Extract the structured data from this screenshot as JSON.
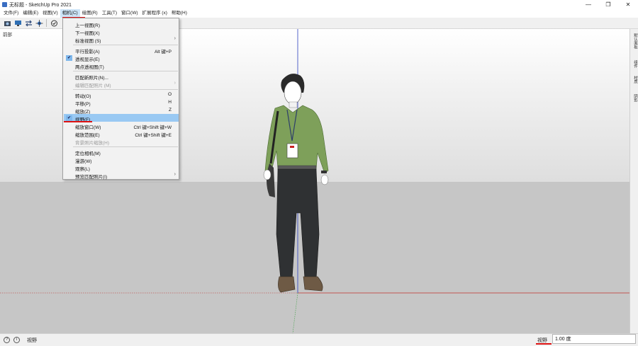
{
  "window": {
    "title": "无标题 - SketchUp Pro 2021",
    "controls": {
      "minimize": "—",
      "maximize": "❐",
      "close": "✕"
    }
  },
  "menubar": [
    {
      "label": "文件(F)"
    },
    {
      "label": "编辑(E)"
    },
    {
      "label": "视图(V)"
    },
    {
      "label": "相机(C)",
      "active": true
    },
    {
      "label": "绘图(R)"
    },
    {
      "label": "工具(T)"
    },
    {
      "label": "窗口(W)"
    },
    {
      "label": "扩展程序 (x)"
    },
    {
      "label": "帮助(H)"
    }
  ],
  "scene": {
    "label": "前部"
  },
  "camera_menu": {
    "items": [
      {
        "label": "上一视图(R)"
      },
      {
        "label": "下一视图(X)"
      },
      {
        "label": "标准视图 (S)",
        "submenu": true
      },
      {
        "separator": true
      },
      {
        "label": "平行投影(A)",
        "shortcut": "Alt 键+P"
      },
      {
        "label": "透视显示(E)",
        "checked": true
      },
      {
        "label": "两点透视图(T)"
      },
      {
        "separator": true
      },
      {
        "label": "匹配新照片(N)..."
      },
      {
        "label": "编辑匹配照片 (M)",
        "submenu": true,
        "disabled": true
      },
      {
        "separator": true
      },
      {
        "label": "转动(O)",
        "shortcut": "O"
      },
      {
        "label": "平移(P)",
        "shortcut": "H"
      },
      {
        "label": "缩放(Z)",
        "shortcut": "Z"
      },
      {
        "label": "视野(F)",
        "checked": true,
        "highlighted": true
      },
      {
        "label": "缩放窗口(W)",
        "shortcut": "Ctrl 键+Shift 键+W"
      },
      {
        "label": "缩放范围(E)",
        "shortcut": "Ctrl 键+Shift 键+E"
      },
      {
        "label": "背景照片缩放(H)",
        "disabled": true
      },
      {
        "separator": true
      },
      {
        "label": "定位相机(M)"
      },
      {
        "label": "漫游(W)"
      },
      {
        "label": "观察(L)"
      },
      {
        "label": "预览匹配照片(I)",
        "submenu": true
      }
    ]
  },
  "right_tray": {
    "tabs": [
      "默认面板",
      "组件",
      "材质",
      "阴影"
    ]
  },
  "statusbar": {
    "icon1": "?",
    "icon2": "i",
    "message": "视野",
    "measurements_label": "视野",
    "measurements_value": "1.00 度"
  },
  "colors": {
    "menu_highlight": "#99c9f3",
    "red_axis": "#c0302a",
    "blue_axis": "#2b3fbf",
    "green_axis": "#3aa040",
    "annotation_underline": "#d11111"
  }
}
